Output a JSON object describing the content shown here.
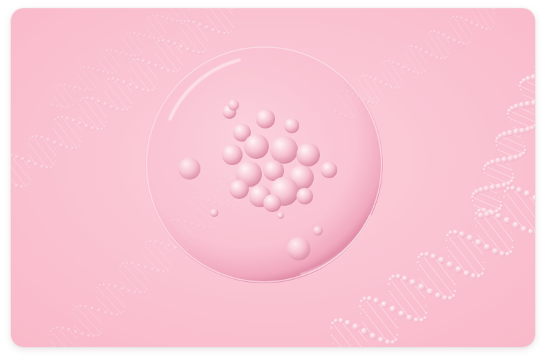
{
  "image": {
    "subject": "",
    "colors": {
      "background": "#f9b8c9",
      "background_light": "#fcd0dc",
      "bead": "#fde7ee",
      "bubble_rim": "#e58aa8",
      "sphere_light": "#fff3f6",
      "sphere_mid": "#f6c2d1",
      "sphere_shadow": "#d9899f"
    },
    "icons": [
      "dna-helix-icon",
      "bubble-icon",
      "cell-cluster-icon"
    ]
  }
}
